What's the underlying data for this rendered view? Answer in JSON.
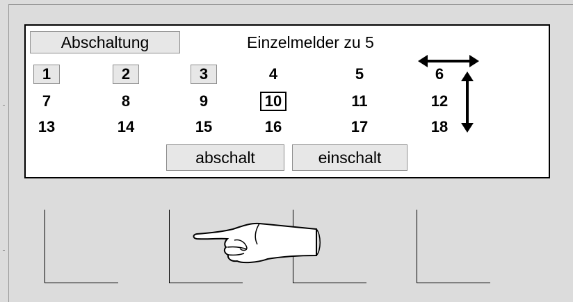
{
  "panel": {
    "shutdown_label": "Abschaltung",
    "title": "Einzelmelder zu 5",
    "detectors": [
      {
        "label": "1",
        "state": "boxed"
      },
      {
        "label": "2",
        "state": "boxed"
      },
      {
        "label": "3",
        "state": "boxed"
      },
      {
        "label": "4",
        "state": "plain"
      },
      {
        "label": "5",
        "state": "plain"
      },
      {
        "label": "6",
        "state": "plain"
      },
      {
        "label": "7",
        "state": "plain"
      },
      {
        "label": "8",
        "state": "plain"
      },
      {
        "label": "9",
        "state": "plain"
      },
      {
        "label": "10",
        "state": "selected"
      },
      {
        "label": "11",
        "state": "plain"
      },
      {
        "label": "12",
        "state": "plain"
      },
      {
        "label": "13",
        "state": "plain"
      },
      {
        "label": "14",
        "state": "plain"
      },
      {
        "label": "15",
        "state": "plain"
      },
      {
        "label": "16",
        "state": "plain"
      },
      {
        "label": "17",
        "state": "plain"
      },
      {
        "label": "18",
        "state": "plain"
      }
    ],
    "disable_button": "abschalt",
    "enable_button": "einschalt"
  },
  "icons": {
    "horizontal_arrow": "double-arrow-horizontal-icon",
    "vertical_arrow": "double-arrow-vertical-icon",
    "pointer": "pointing-hand-icon"
  },
  "colors": {
    "background": "#dcdcdc",
    "panel": "#ffffff",
    "button": "#e7e7e7"
  }
}
